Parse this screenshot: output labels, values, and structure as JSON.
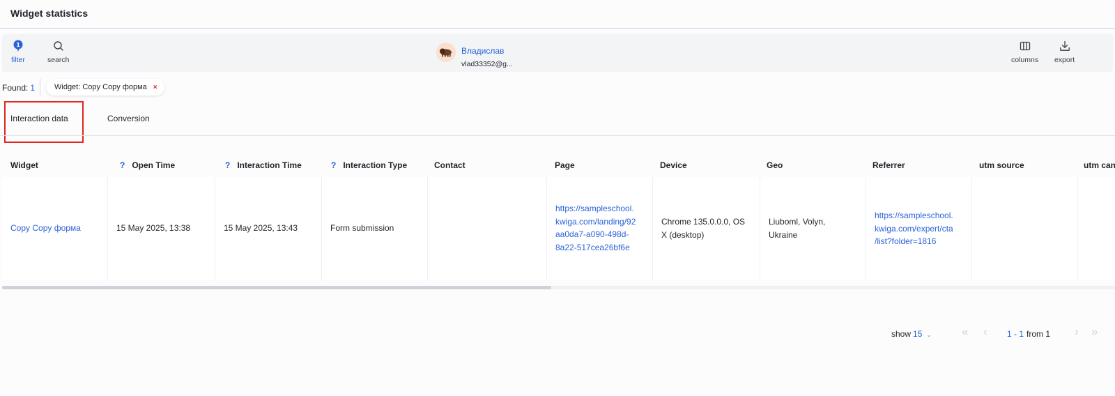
{
  "page": {
    "title": "Widget statistics"
  },
  "toolbar": {
    "filter_label": "filter",
    "filter_badge": "1",
    "search_label": "search",
    "columns_label": "columns",
    "export_label": "export"
  },
  "filters": {
    "found_label": "Found:",
    "found_count": "1",
    "chip_label": "Widget: Copy Copy форма",
    "chip_remove": "×"
  },
  "tabs": [
    {
      "label": "Interaction data",
      "selected": true
    },
    {
      "label": "Conversion",
      "selected": false
    }
  ],
  "table": {
    "help_mark": "?",
    "headers": {
      "widget": "Widget",
      "open_time": "Open Time",
      "interaction_time": "Interaction Time",
      "interaction_type": "Interaction Type",
      "contact": "Contact",
      "page": "Page",
      "device": "Device",
      "geo": "Geo",
      "referrer": "Referrer",
      "utm_source": "utm source",
      "utm_campaign": "utm can"
    },
    "rows": [
      {
        "widget": "Copy Copy форма",
        "open_time": "15 May 2025, 13:38",
        "interaction_time": "15 May 2025, 13:43",
        "interaction_type": "Form submission",
        "contact_name": "Владислав",
        "contact_email": "vlad33352@g...",
        "page_lines": [
          "https://sampleschool.",
          "kwiga.com/landing/92",
          "aa0da7-a090-498d-",
          "8a22-517cea26bf6e"
        ],
        "device_lines": [
          "Chrome 135.0.0.0, OS",
          "X (desktop)"
        ],
        "geo_lines": [
          "Liuboml, Volyn,",
          "Ukraine"
        ],
        "referrer_lines": [
          "https://sampleschool.",
          "kwiga.com/expert/cta",
          "/list?folder=1816"
        ],
        "utm_source": "",
        "utm_campaign": ""
      }
    ]
  },
  "pagination": {
    "show_label": "show",
    "per_page": "15",
    "range": "1 - 1",
    "from_label": "from 1",
    "first_icon": "«",
    "prev_icon": "‹",
    "next_icon": "›",
    "last_icon": "»"
  },
  "colors": {
    "accent": "#2a62d8",
    "highlight": "#e0261f",
    "remove": "#d62d2d"
  }
}
